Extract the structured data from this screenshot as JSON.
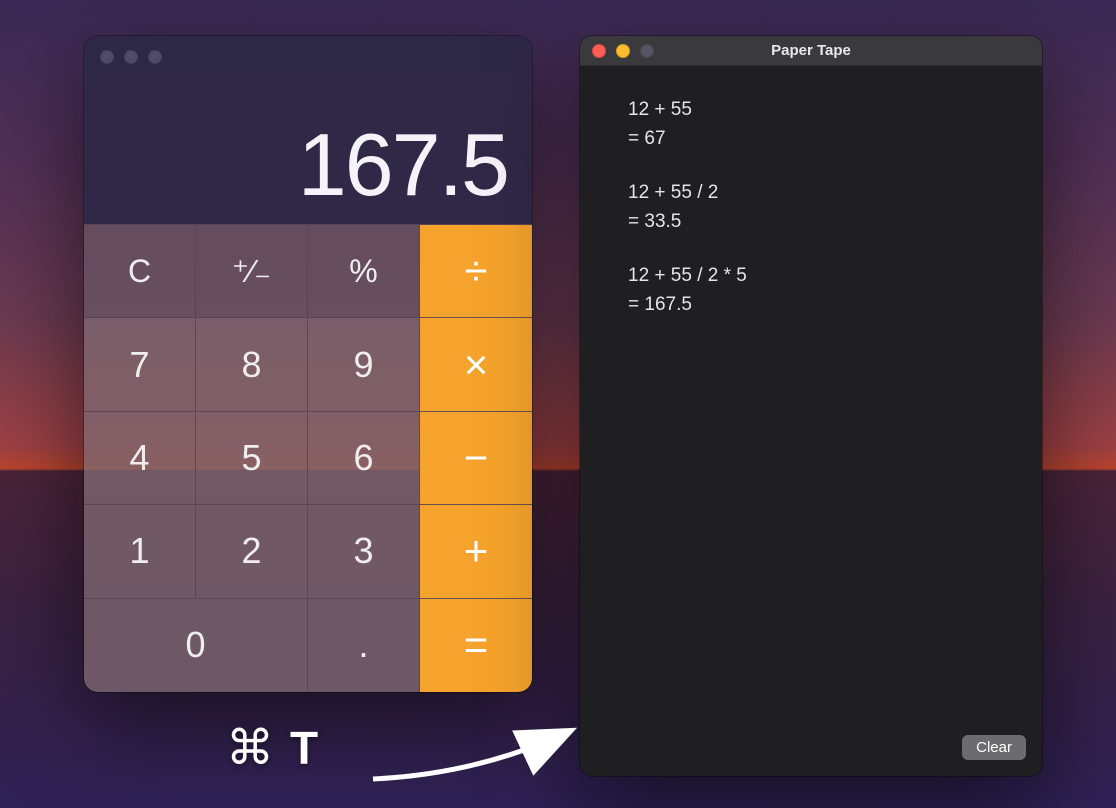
{
  "calculator": {
    "display": "167.5",
    "keys": {
      "clear": "C",
      "plusminus": "⁺∕₋",
      "percent": "%",
      "divide": "÷",
      "seven": "7",
      "eight": "8",
      "nine": "9",
      "multiply": "×",
      "four": "4",
      "five": "5",
      "six": "6",
      "minus": "−",
      "one": "1",
      "two": "2",
      "three": "3",
      "plus": "+",
      "zero": "0",
      "decimal": ".",
      "equals": "="
    }
  },
  "paper_tape": {
    "title": "Paper Tape",
    "entries": [
      {
        "expr": "12 + 55",
        "result": "= 67"
      },
      {
        "expr": "12 + 55 / 2",
        "result": "= 33.5"
      },
      {
        "expr": "12 + 55 / 2 * 5",
        "result": "= 167.5"
      }
    ],
    "clear_label": "Clear"
  },
  "annotation": {
    "command_symbol": "⌘",
    "key": "T"
  }
}
